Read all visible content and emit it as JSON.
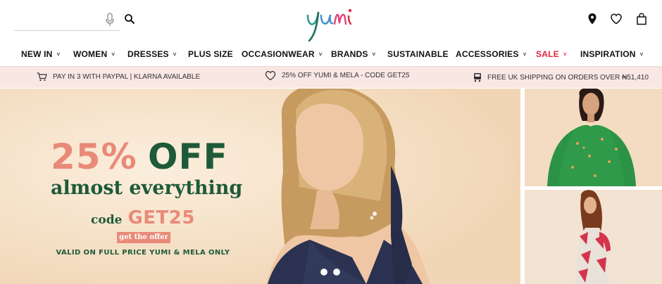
{
  "header": {
    "logo_text": "yumi",
    "search": {
      "value": "",
      "placeholder": ""
    },
    "icons": [
      "microphone-icon",
      "search-icon",
      "location-pin-icon",
      "heart-icon",
      "shopping-bag-icon"
    ]
  },
  "nav": {
    "items": [
      {
        "label": "NEW IN",
        "dropdown": true
      },
      {
        "label": "WOMEN",
        "dropdown": true
      },
      {
        "label": "DRESSES",
        "dropdown": true
      },
      {
        "label": "PLUS SIZE",
        "dropdown": false
      },
      {
        "label": "OCCASIONWEAR",
        "dropdown": true
      },
      {
        "label": "BRANDS",
        "dropdown": true
      },
      {
        "label": "SUSTAINABLE",
        "dropdown": false
      },
      {
        "label": "ACCESSORIES",
        "dropdown": true
      },
      {
        "label": "SALE",
        "dropdown": true
      },
      {
        "label": "INSPIRATION",
        "dropdown": true
      }
    ],
    "chevron": "˅"
  },
  "promo": {
    "items": [
      {
        "icon": "cart-icon",
        "text": "PAY IN 3 WITH PAYPAL | KLARNA AVAILABLE"
      },
      {
        "icon": "heart-icon",
        "text": "25% OFF YUMI & MELA - CODE GET25"
      },
      {
        "icon": "delivery-truck-icon",
        "text": "FREE UK SHIPPING ON ORDERS OVER ₦51,410"
      }
    ]
  },
  "hero": {
    "percent": "25%",
    "off": "OFF",
    "subtitle": "almost everything",
    "code_word": "code",
    "code": "GET25",
    "cta": "get the offer",
    "terms": "VALID ON FULL PRICE YUMI & MELA ONLY",
    "slides": 2,
    "active_slide": 1
  },
  "colors": {
    "brand_green": "#1e5a39",
    "brand_coral": "#e98a79",
    "sale_red": "#e0243b",
    "promo_bg": "#f9e7e4",
    "hero_bg": "#f5dfc4"
  }
}
